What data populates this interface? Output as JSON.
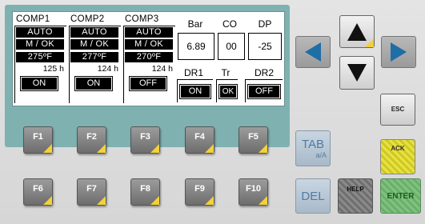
{
  "compressors": [
    {
      "title": "COMP1",
      "mode": "AUTO",
      "status": "M / OK",
      "temp": "275ºF",
      "hours": "125 h",
      "state": "ON"
    },
    {
      "title": "COMP2",
      "mode": "AUTO",
      "status": "M / OK",
      "temp": "277ºF",
      "hours": "124 h",
      "state": "ON"
    },
    {
      "title": "COMP3",
      "mode": "AUTO",
      "status": "M / OK",
      "temp": "270ºF",
      "hours": "124 h",
      "state": "OFF"
    }
  ],
  "values": [
    {
      "label": "Bar",
      "value": "6.89"
    },
    {
      "label": "CO",
      "value": "00"
    },
    {
      "label": "DP",
      "value": "-25"
    }
  ],
  "indicators": [
    {
      "label": "DR1",
      "value": "ON"
    },
    {
      "label": "Tr",
      "value": "OK"
    },
    {
      "label": "DR2",
      "value": "OFF"
    }
  ],
  "function_keys": [
    "F1",
    "F2",
    "F3",
    "F4",
    "F5",
    "F6",
    "F7",
    "F8",
    "F9",
    "F10"
  ],
  "keys": {
    "tab": "TAB",
    "tab_sub": "a/A",
    "del": "DEL",
    "help": "HELP",
    "esc": "ESC",
    "ack": "ACK",
    "enter": "ENTER"
  },
  "colors": {
    "screen_bezel": "#7fb1b1",
    "key_accent": "#f3d13a",
    "ack": "#e6e03a",
    "enter": "#7fc27f",
    "tab_text": "#4f7aa6"
  }
}
